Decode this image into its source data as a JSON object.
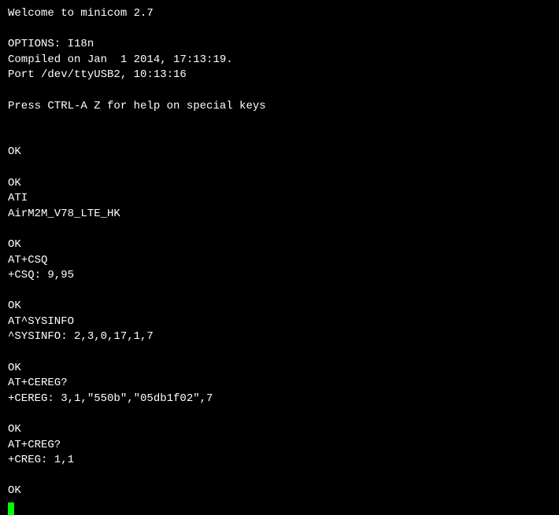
{
  "header": {
    "welcome": "Welcome to minicom 2.7",
    "options": "OPTIONS: I18n",
    "compiled": "Compiled on Jan  1 2014, 17:13:19.",
    "port": "Port /dev/ttyUSB2, 10:13:16",
    "help": "Press CTRL-A Z for help on special keys"
  },
  "session": {
    "ok1": "OK",
    "ok2": "OK",
    "cmd_ati": "ATI",
    "resp_ati": "AirM2M_V78_LTE_HK",
    "ok3": "OK",
    "cmd_csq": "AT+CSQ",
    "resp_csq": "+CSQ: 9,95",
    "ok4": "OK",
    "cmd_sysinfo": "AT^SYSINFO",
    "resp_sysinfo": "^SYSINFO: 2,3,0,17,1,7",
    "ok5": "OK",
    "cmd_cereg": "AT+CEREG?",
    "resp_cereg": "+CEREG: 3,1,\"550b\",\"05db1f02\",7",
    "ok6": "OK",
    "cmd_creg": "AT+CREG?",
    "resp_creg": "+CREG: 1,1",
    "ok7": "OK"
  }
}
